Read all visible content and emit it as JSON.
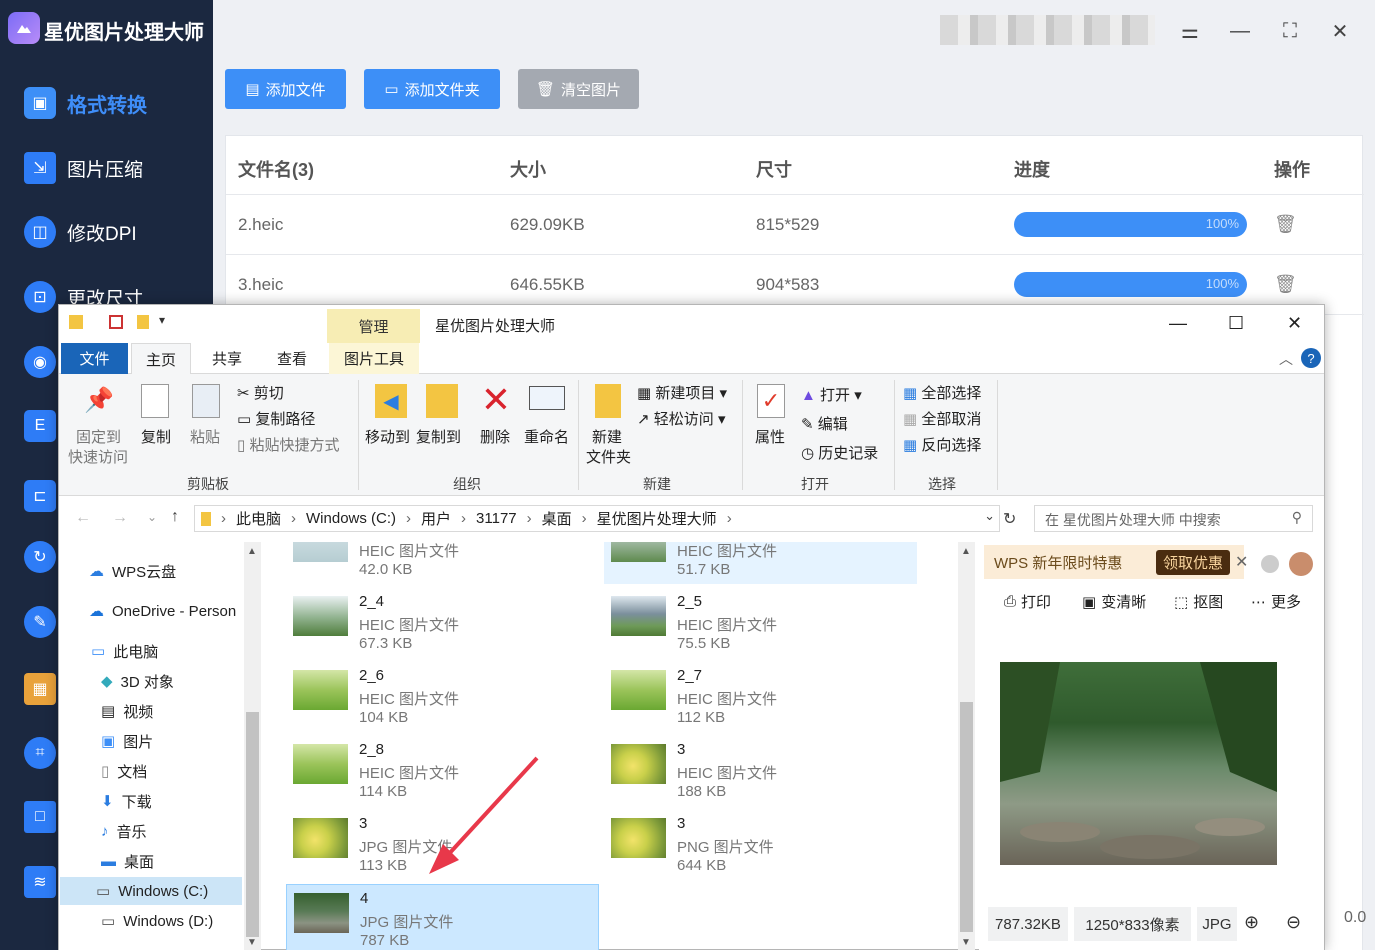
{
  "app": {
    "title": "星优图片处理大师",
    "nav": [
      {
        "label": "格式转换",
        "icon": "image-convert-icon",
        "active": true
      },
      {
        "label": "图片压缩",
        "icon": "compress-icon"
      },
      {
        "label": "修改DPI",
        "icon": "dpi-icon"
      },
      {
        "label": "更改尺寸",
        "icon": "resize-icon"
      }
    ],
    "toolbar": {
      "add_file": "添加文件",
      "add_folder": "添加文件夹",
      "clear": "清空图片"
    },
    "table": {
      "headers": [
        "文件名(3)",
        "大小",
        "尺寸",
        "进度",
        "操作"
      ],
      "rows": [
        {
          "name": "2.heic",
          "size": "629.09KB",
          "dim": "815*529",
          "progress": "100%"
        },
        {
          "name": "3.heic",
          "size": "646.55KB",
          "dim": "904*583",
          "progress": "100%"
        }
      ],
      "partial_text": "0.0"
    }
  },
  "explorer": {
    "context_tab": "管理",
    "title": "星优图片处理大师",
    "tabs": [
      "文件",
      "主页",
      "共享",
      "查看",
      "图片工具"
    ],
    "ribbon": {
      "pin": [
        "固定到",
        "快速访问"
      ],
      "copy": "复制",
      "paste": "粘贴",
      "cut": "剪切",
      "copy_path": "复制路径",
      "paste_shortcut": "粘贴快捷方式",
      "clipboard_group": "剪贴板",
      "move_to": "移动到",
      "copy_to": "复制到",
      "delete": "删除",
      "rename": "重命名",
      "organize_group": "组织",
      "new_folder": [
        "新建",
        "文件夹"
      ],
      "new_item": "新建项目",
      "easy_access": "轻松访问",
      "new_group": "新建",
      "properties": "属性",
      "open": "打开",
      "edit": "编辑",
      "history": "历史记录",
      "open_group": "打开",
      "select_all": "全部选择",
      "select_none": "全部取消",
      "invert": "反向选择",
      "select_group": "选择"
    },
    "address": [
      "此电脑",
      "Windows (C:)",
      "用户",
      "31177",
      "桌面",
      "星优图片处理大师"
    ],
    "search_placeholder": "在 星优图片处理大师 中搜索",
    "nav_items": [
      {
        "label": "WPS云盘",
        "icon": "cloud-icon"
      },
      {
        "label": "OneDrive - Person",
        "icon": "onedrive-icon"
      },
      {
        "label": "此电脑",
        "icon": "computer-icon"
      },
      {
        "label": "3D 对象",
        "icon": "cube-icon"
      },
      {
        "label": "视频",
        "icon": "video-icon"
      },
      {
        "label": "图片",
        "icon": "picture-icon"
      },
      {
        "label": "文档",
        "icon": "document-icon"
      },
      {
        "label": "下载",
        "icon": "download-icon"
      },
      {
        "label": "音乐",
        "icon": "music-icon"
      },
      {
        "label": "桌面",
        "icon": "desktop-icon"
      },
      {
        "label": "Windows (C:)",
        "icon": "drive-icon",
        "selected": true
      },
      {
        "label": "Windows (D:)",
        "icon": "drive-icon"
      }
    ],
    "files": [
      {
        "name": "",
        "type": "HEIC 图片文件",
        "size": "42.0 KB",
        "thumb": "pale"
      },
      {
        "name": "",
        "type": "HEIC 图片文件",
        "size": "51.7 KB",
        "thumb": "hills",
        "highlight": true
      },
      {
        "name": "2_4",
        "type": "HEIC 图片文件",
        "size": "67.3 KB",
        "thumb": "valley"
      },
      {
        "name": "2_5",
        "type": "HEIC 图片文件",
        "size": "75.5 KB",
        "thumb": "mountain"
      },
      {
        "name": "2_6",
        "type": "HEIC 图片文件",
        "size": "104 KB",
        "thumb": "green"
      },
      {
        "name": "2_7",
        "type": "HEIC 图片文件",
        "size": "112 KB",
        "thumb": "green"
      },
      {
        "name": "2_8",
        "type": "HEIC 图片文件",
        "size": "114 KB",
        "thumb": "green"
      },
      {
        "name": "3",
        "type": "HEIC 图片文件",
        "size": "188 KB",
        "thumb": "flower"
      },
      {
        "name": "3",
        "type": "JPG 图片文件",
        "size": "113 KB",
        "thumb": "flower"
      },
      {
        "name": "3",
        "type": "PNG 图片文件",
        "size": "644 KB",
        "thumb": "flower"
      },
      {
        "name": "4",
        "type": "JPG 图片文件",
        "size": "787 KB",
        "thumb": "forest",
        "selected": true
      }
    ],
    "preview": {
      "wps_promo": "WPS 新年限时特惠",
      "wps_button": "领取优惠",
      "tools": [
        "打印",
        "变清晰",
        "抠图",
        "更多"
      ],
      "size": "787.32KB",
      "dims": "1250*833像素",
      "format": "JPG"
    }
  }
}
